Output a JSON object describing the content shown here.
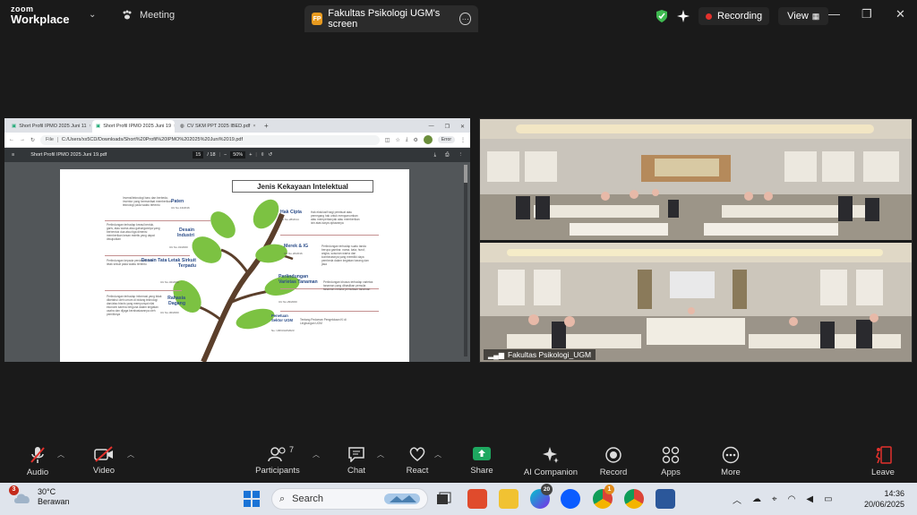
{
  "app": {
    "logo_line1": "zoom",
    "logo_line2": "Workplace",
    "meeting_label": "Meeting",
    "share_badge": "FP",
    "share_tab_label": "Fakultas Psikologi UGM's screen",
    "recording_label": "Recording",
    "view_label": "View"
  },
  "browser": {
    "tabs": [
      {
        "label": "Short Profil IPMO 2025 Juni 11"
      },
      {
        "label": "Short Profil IPMO 2025 Juni 19"
      },
      {
        "label": "CV SKM PPT 2025 IBED.pdf"
      }
    ],
    "url_scheme": "File",
    "url": "C:/Users/xx5CD/Downloads/Short%20Profil%20IPMO%202025%20Juni%2019.pdf",
    "error_label": "Error",
    "pdf_title": "Short Profil IPMO 2025 Juni 19.pdf",
    "page_current": "15",
    "page_total": "/ 18",
    "zoom": "50%"
  },
  "slide": {
    "title": "Jenis Kekayaan Intelektual",
    "items": [
      {
        "head": "Paten",
        "law": "UU No.13/2016",
        "desc": "Invensi/teknologi baru dan berbeda, inventor yang bermanfaat memberikan teknologi pada waktu tertentu"
      },
      {
        "head": "Desain Industri",
        "law": "UU No.31/2000",
        "desc": "Perlindungan terhadap kreasi bentuk, garis, atau warna atau gabungannya yang berbentuk dua atau tiga dimensi memberikan kesan estetis yang dapat diwujudkan"
      },
      {
        "head": "Desain Tata Letak Sirkuit Terpadu",
        "law": "UU No.32/2000",
        "desc": "Perlindungan kepada pendesain tata letak sirkuit pada waktu tertentu"
      },
      {
        "head": "Rahasia Dagang",
        "law": "UU No.30/2000",
        "desc": "Perlindungan terhadap informasi yang tidak diketahui oleh umum di bidang teknologi dan/atau bisnis yang mempunyai nilai ekonomi karena berguna dalam kegiatan usaha dan dijaga kerahasiaannya oleh pemiliknya"
      },
      {
        "head": "Hak Cipta",
        "law": "UU No.28/2014",
        "desc": "Hak eksklusif bagi pembuat atau pemegang hak untuk mengumumkan atau memperbanyak atau memberikan izin atas karya ciptaannya"
      },
      {
        "head": "Merek & IG",
        "law": "UU No.20/2016",
        "desc": "Perlindungan terhadap suatu tanda berupa gambar, nama, kata, huruf, angka, susunan warna dan kombinasinya yang memiliki daya pembeda dalam kegiatan barang dan jasa"
      },
      {
        "head": "Perlindungan Varietas Tanaman",
        "law": "UU No.29/2000",
        "desc": "Perlindungan khusus terhadap varietas tanaman yang dihasilkan pemulia tanaman melalui pemuliaan tanaman"
      },
      {
        "head": "Penetuan Sektor UGM",
        "law": "No. UM/UGM/2023",
        "desc": "Tentang Pedoman Pengelolaan KI di Lingkungan UGM"
      }
    ]
  },
  "camera": {
    "participant": "Fakultas Psikologi_UGM"
  },
  "toolbar": {
    "audio": "Audio",
    "video": "Video",
    "participants": "Participants",
    "participants_count": "7",
    "chat": "Chat",
    "react": "React",
    "share": "Share",
    "ai": "AI Companion",
    "record": "Record",
    "apps": "Apps",
    "more": "More",
    "leave": "Leave"
  },
  "taskbar": {
    "weather_badge": "3",
    "temperature": "30°C",
    "condition": "Berawan",
    "search_label": "Search",
    "canva_badge": "20",
    "chrome_badge": "1",
    "time": "14:36",
    "date": "20/06/2025"
  },
  "colors": {
    "zoom_bg": "#1a1a1a",
    "rec_red": "#e2312c",
    "shield_green": "#3fb950",
    "share_green": "#1ea860",
    "leaf_green": "#7cc242",
    "branch_brown": "#5b3f2b",
    "heading_blue": "#2d4e8a"
  }
}
